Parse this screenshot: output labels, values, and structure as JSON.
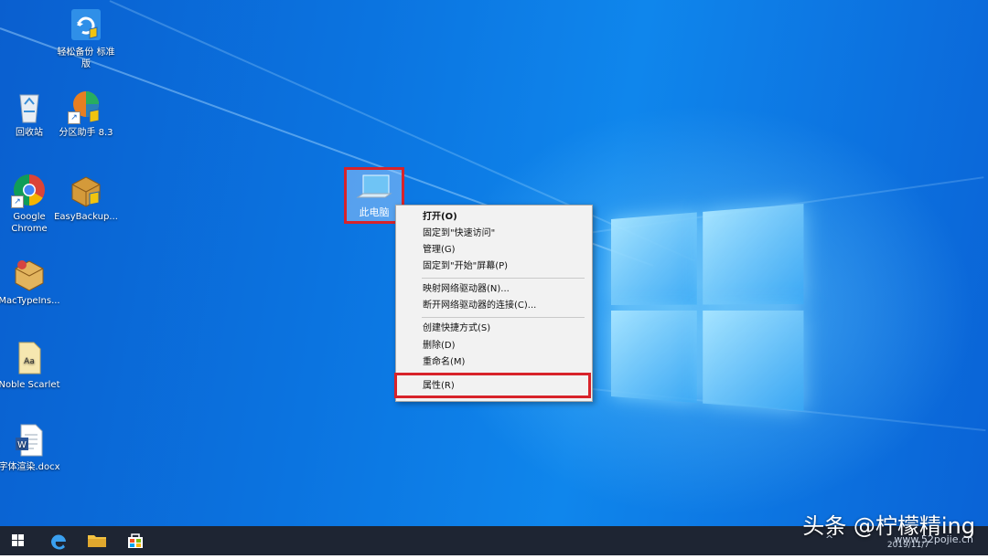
{
  "desktop_icons": [
    {
      "label": "轻松备份 标准版",
      "icon": "backup-icon"
    },
    {
      "label": "回收站",
      "icon": "recycle-bin-icon"
    },
    {
      "label": "分区助手 8.3",
      "icon": "partition-assistant-icon"
    },
    {
      "label": "Google Chrome",
      "icon": "chrome-icon"
    },
    {
      "label": "EasyBackup...",
      "icon": "easybackup-icon"
    },
    {
      "label": "MacTypeIns...",
      "icon": "installer-box-icon"
    },
    {
      "label": "Noble Scarlet",
      "icon": "font-file-icon"
    },
    {
      "label": "字体渲染.docx",
      "icon": "word-document-icon"
    }
  ],
  "this_pc": {
    "label": "此电脑",
    "icon": "computer-icon"
  },
  "context_menu": {
    "items": [
      {
        "label": "打开(O)",
        "bold": true
      },
      {
        "label": "固定到\"快速访问\""
      },
      {
        "label": "管理(G)"
      },
      {
        "label": "固定到\"开始\"屏幕(P)"
      },
      {
        "label": "映射网络驱动器(N)..."
      },
      {
        "label": "断开网络驱动器的连接(C)..."
      },
      {
        "label": "创建快捷方式(S)"
      },
      {
        "label": "删除(D)"
      },
      {
        "label": "重命名(M)"
      },
      {
        "label": "属性(R)"
      }
    ]
  },
  "taskbar": {
    "start_icon": "windows-start-icon",
    "apps": [
      "edge-icon",
      "file-explorer-icon",
      "store-icon"
    ],
    "clock_date": "2019/11/7",
    "tray_chevron": "^"
  },
  "watermark": {
    "text": "头条 @柠檬精ing",
    "site": "www.52pojie.cn"
  },
  "colors": {
    "highlight_border": "#d8232a",
    "taskbar": "#1e2533",
    "desktop_blue": "#0b74e0"
  }
}
